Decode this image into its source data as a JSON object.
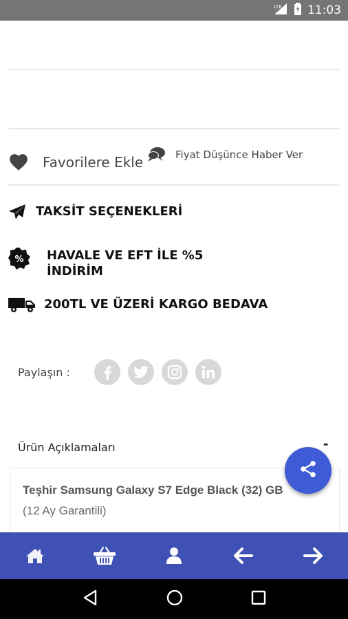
{
  "status_bar": {
    "time": "11:03",
    "network": "LTE",
    "icons": [
      "signal-icon",
      "battery-icon"
    ]
  },
  "favorites": {
    "label": "Favorilere Ekle",
    "icon": "heart-icon"
  },
  "price_alert": {
    "label": "Fiyat Düşünce Haber Ver",
    "icon": "chat-bubbles-icon"
  },
  "features": [
    {
      "icon": "paper-plane-icon",
      "lines": [
        "TAKSİT SEÇENEKLERİ"
      ]
    },
    {
      "icon": "percent-badge-icon",
      "lines": [
        "HAVALE VE EFT İLE %5",
        "İNDİRİM"
      ]
    },
    {
      "icon": "truck-icon",
      "lines": [
        "200TL VE ÜZERİ KARGO BEDAVA"
      ]
    }
  ],
  "share": {
    "label": "Paylaşın :",
    "networks": [
      "facebook-icon",
      "twitter-icon",
      "instagram-icon",
      "linkedin-icon"
    ]
  },
  "description": {
    "title": "Ürün Açıklamaları",
    "collapse_sign": "-",
    "line1": "Teşhir Samsung Galaxy S7 Edge Black (32) GB",
    "line2": "(12 Ay Garantili)"
  },
  "fab": {
    "icon": "share-icon"
  },
  "bottom_nav": [
    "home-icon",
    "basket-icon",
    "user-icon",
    "arrow-left-icon",
    "arrow-right-icon"
  ],
  "android_nav": [
    "back-icon",
    "home-circle-icon",
    "recents-icon"
  ],
  "colors": {
    "primary": "#3f51b5",
    "fab": "#3f5bd6",
    "status_bar": "#757575"
  }
}
